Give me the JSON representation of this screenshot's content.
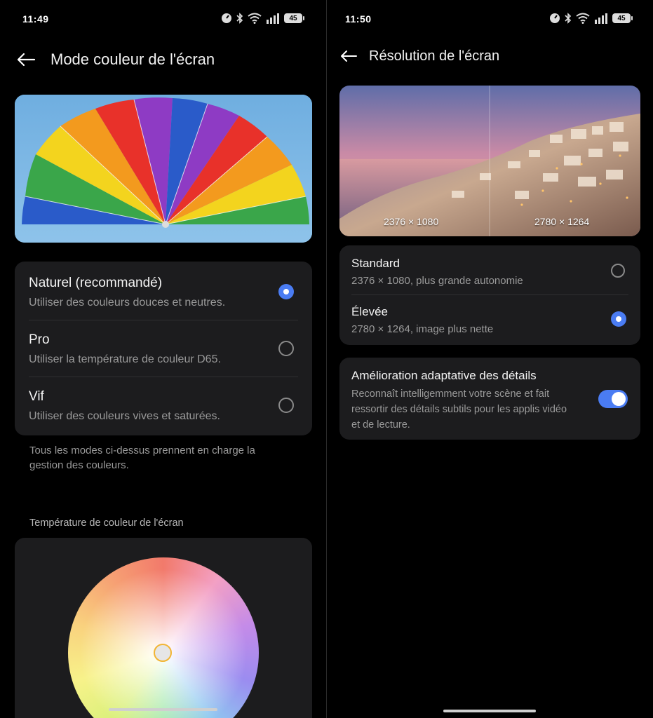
{
  "left": {
    "status": {
      "time": "11:49",
      "battery": "45"
    },
    "header": {
      "title": "Mode couleur de l'écran"
    },
    "options": [
      {
        "title": "Naturel (recommandé)",
        "subtitle": "Utiliser des couleurs douces et neutres.",
        "selected": true
      },
      {
        "title": "Pro",
        "subtitle": "Utiliser la température de couleur D65.",
        "selected": false
      },
      {
        "title": "Vif",
        "subtitle": "Utiliser des couleurs vives et saturées.",
        "selected": false
      }
    ],
    "note_line1": "Tous les modes ci-dessus prennent en charge la",
    "note_line2": "gestion des couleurs.",
    "temperature_section": "Température de couleur de l'écran"
  },
  "right": {
    "status": {
      "time": "11:50",
      "battery": "45"
    },
    "header": {
      "title": "Résolution de l'écran"
    },
    "preview": {
      "label_left": "2376 × 1080",
      "label_right": "2780 × 1264"
    },
    "options": [
      {
        "title": "Standard",
        "subtitle": "2376 × 1080, plus grande autonomie",
        "selected": false
      },
      {
        "title": "Élevée",
        "subtitle": "2780 × 1264, image plus nette",
        "selected": true
      }
    ],
    "adaptive": {
      "title": "Amélioration adaptative des détails",
      "desc_line1": "Reconnaît intelligemment votre scène et fait",
      "desc_line2": "ressortir des détails subtils pour les applis vidéo",
      "desc_line3": "et de lecture.",
      "enabled": true
    }
  },
  "icons": {
    "back": "arrow-left-icon",
    "status": [
      "speed-icon",
      "bluetooth-icon",
      "wifi-icon",
      "signal-icon",
      "battery-icon"
    ]
  },
  "colors": {
    "accent": "#4a7cf3",
    "card": "#1c1c1e",
    "background": "#000000"
  }
}
